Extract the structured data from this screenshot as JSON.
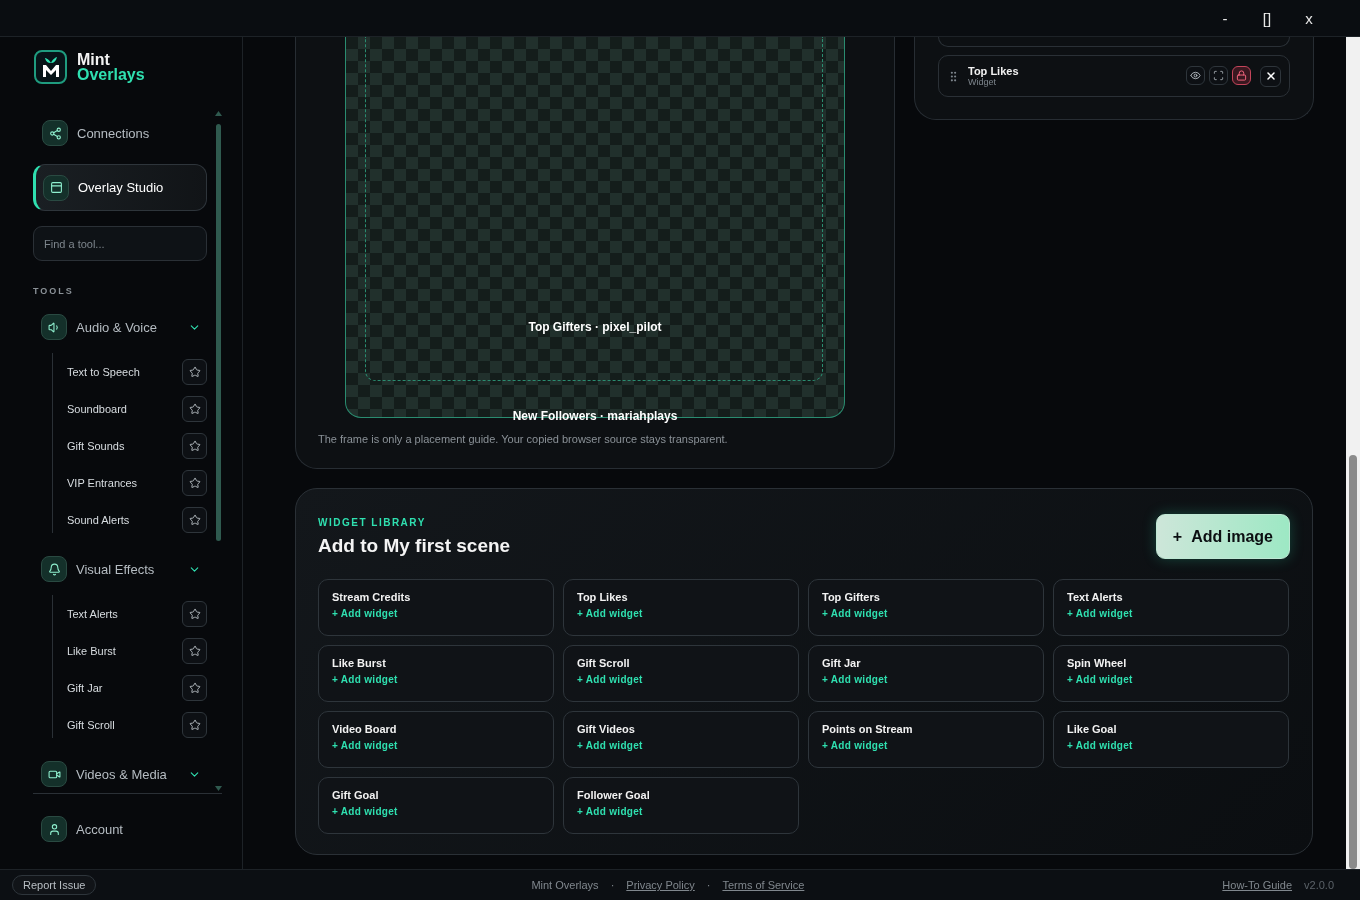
{
  "window": {
    "controls": [
      "-",
      "[]",
      "x"
    ]
  },
  "brand": {
    "name": "Mint",
    "subtitle": "Overlays"
  },
  "nav": [
    {
      "label": "Connections",
      "selected": false
    },
    {
      "label": "Overlay Studio",
      "selected": true
    }
  ],
  "search": {
    "placeholder": "Find a tool..."
  },
  "tools": {
    "heading": "TOOLS",
    "groups": [
      {
        "label": "Audio & Voice",
        "expanded": true,
        "children": [
          {
            "label": "Text to Speech",
            "starred": false
          },
          {
            "label": "Soundboard",
            "starred": false
          },
          {
            "label": "Gift Sounds",
            "starred": false
          },
          {
            "label": "VIP Entrances",
            "starred": false
          },
          {
            "label": "Sound Alerts",
            "starred": false
          }
        ]
      },
      {
        "label": "Visual Effects",
        "expanded": true,
        "children": [
          {
            "label": "Text Alerts",
            "starred": false
          },
          {
            "label": "Like Burst",
            "starred": false
          },
          {
            "label": "Gift Jar",
            "starred": false
          },
          {
            "label": "Gift Scroll",
            "starred": false
          }
        ]
      },
      {
        "label": "Videos & Media",
        "expanded": true
      }
    ]
  },
  "account": {
    "label": "Account"
  },
  "canvas": {
    "labels": [
      "Top Gifters · pixel_pilot",
      "New Followers · mariahplays"
    ],
    "caption": "The frame is only a placement guide. Your copied browser source stays transparent."
  },
  "layers": [
    {
      "name": "Top Likes",
      "type": "Widget",
      "locked": true
    }
  ],
  "library": {
    "eyebrow": "WIDGET LIBRARY",
    "title": "Add to My first scene",
    "add_image": {
      "icon": "+",
      "label": "Add image"
    },
    "widgets": [
      {
        "name": "Stream Credits",
        "action": "+ Add widget"
      },
      {
        "name": "Top Likes",
        "action": "+ Add widget"
      },
      {
        "name": "Top Gifters",
        "action": "+ Add widget"
      },
      {
        "name": "Text Alerts",
        "action": "+ Add widget"
      },
      {
        "name": "Like Burst",
        "action": "+ Add widget"
      },
      {
        "name": "Gift Scroll",
        "action": "+ Add widget"
      },
      {
        "name": "Gift Jar",
        "action": "+ Add widget"
      },
      {
        "name": "Spin Wheel",
        "action": "+ Add widget"
      },
      {
        "name": "Video Board",
        "action": "+ Add widget"
      },
      {
        "name": "Gift Videos",
        "action": "+ Add widget"
      },
      {
        "name": "Points on Stream",
        "action": "+ Add widget"
      },
      {
        "name": "Like Goal",
        "action": "+ Add widget"
      },
      {
        "name": "Gift Goal",
        "action": "+ Add widget"
      },
      {
        "name": "Follower Goal",
        "action": "+ Add widget"
      }
    ]
  },
  "footer": {
    "report": "Report Issue",
    "center": [
      {
        "kind": "text",
        "label": "Mint Overlays"
      },
      {
        "kind": "sep",
        "label": "·"
      },
      {
        "kind": "link",
        "label": "Privacy Policy"
      },
      {
        "kind": "sep",
        "label": "·"
      },
      {
        "kind": "link",
        "label": "Terms of Service"
      }
    ],
    "guide": "How-To Guide",
    "version": "v2.0.0"
  }
}
